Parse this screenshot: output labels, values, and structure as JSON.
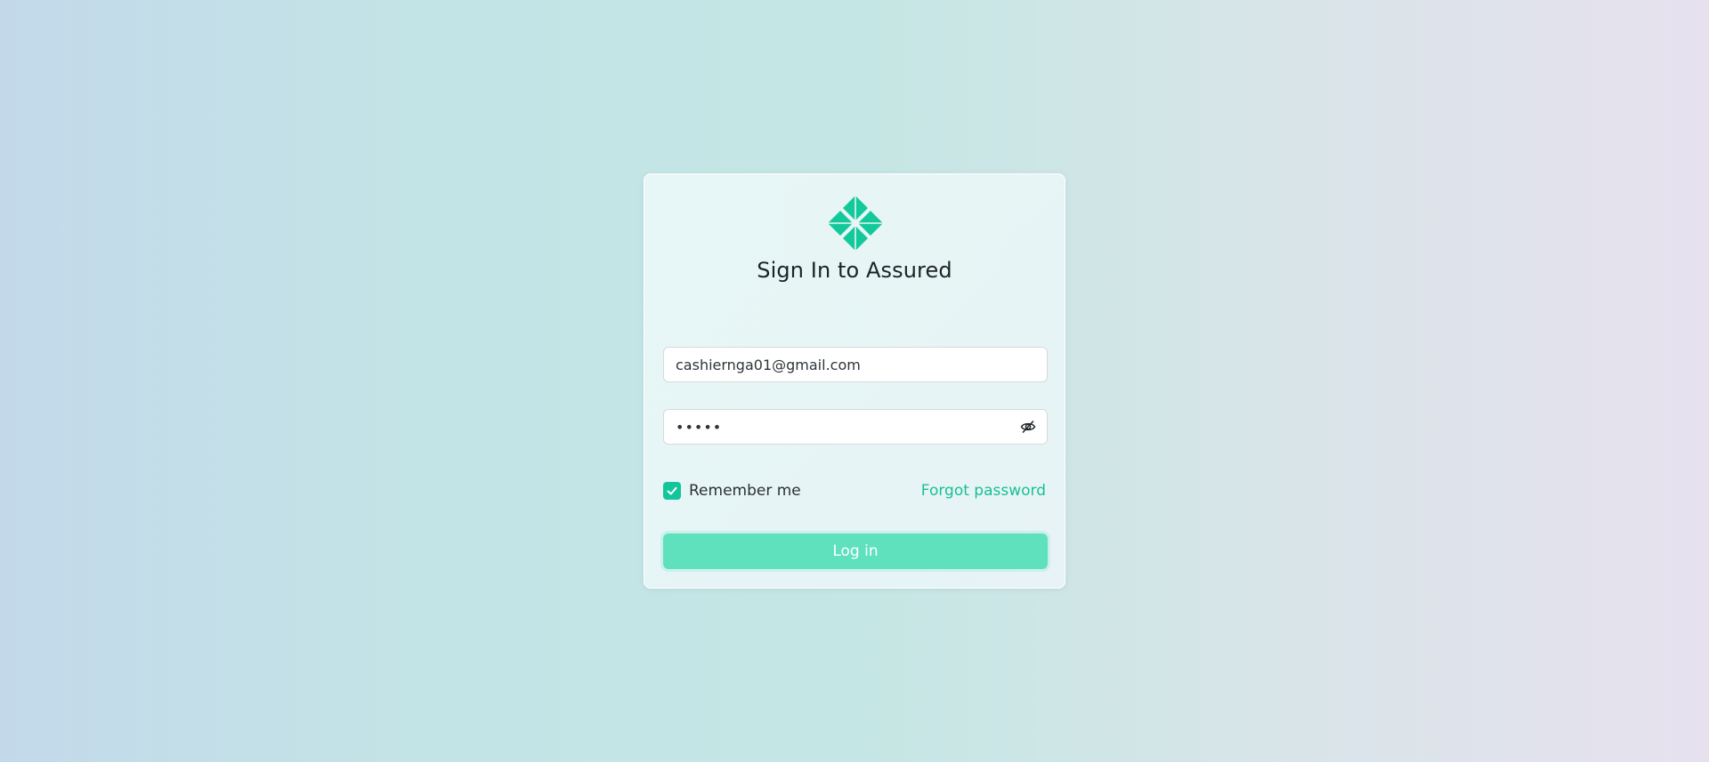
{
  "app": {
    "logo_icon": "assured-logo-icon",
    "brand_color": "#13c69a"
  },
  "login": {
    "title": "Sign In to Assured",
    "email_value": "cashiernga01@gmail.com",
    "email_placeholder": "",
    "password_value": "•••••",
    "password_toggle_icon": "eye-slash-icon",
    "remember_label": "Remember me",
    "remember_checked": true,
    "forgot_label": "Forgot password",
    "login_label": "Log in"
  }
}
